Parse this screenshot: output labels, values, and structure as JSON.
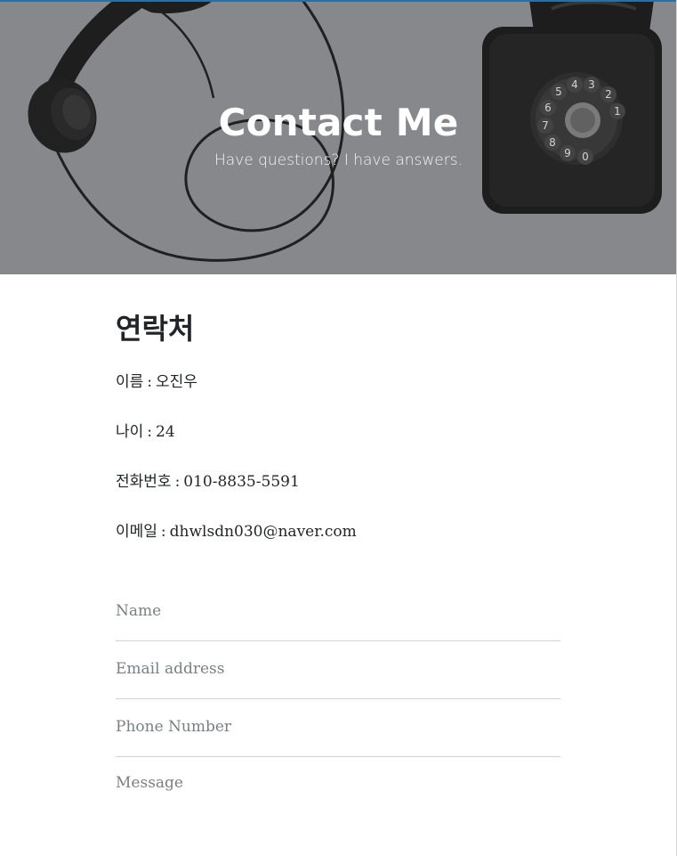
{
  "header": {
    "title": "Contact Me",
    "subtitle": "Have questions? I have answers."
  },
  "section": {
    "title": "연락처",
    "items": [
      {
        "label": "이름",
        "value": "오진우"
      },
      {
        "label": "나이",
        "value": "24"
      },
      {
        "label": "전화번호",
        "value": "010-8835-5591"
      },
      {
        "label": "이메일",
        "value": "dhwlsdn030@naver.com"
      }
    ],
    "separator": ":"
  },
  "form": {
    "name_placeholder": "Name",
    "email_placeholder": "Email address",
    "phone_placeholder": "Phone Number",
    "message_placeholder": "Message"
  },
  "dial_digits": [
    "1",
    "2",
    "3",
    "4",
    "5",
    "6",
    "7",
    "8",
    "9",
    "0"
  ],
  "colors": {
    "header_overlay": "#8a8b8f",
    "top_border": "#2b6fa0",
    "text": "#212529",
    "placeholder": "#7a7f85",
    "divider": "#cfd2d6"
  }
}
